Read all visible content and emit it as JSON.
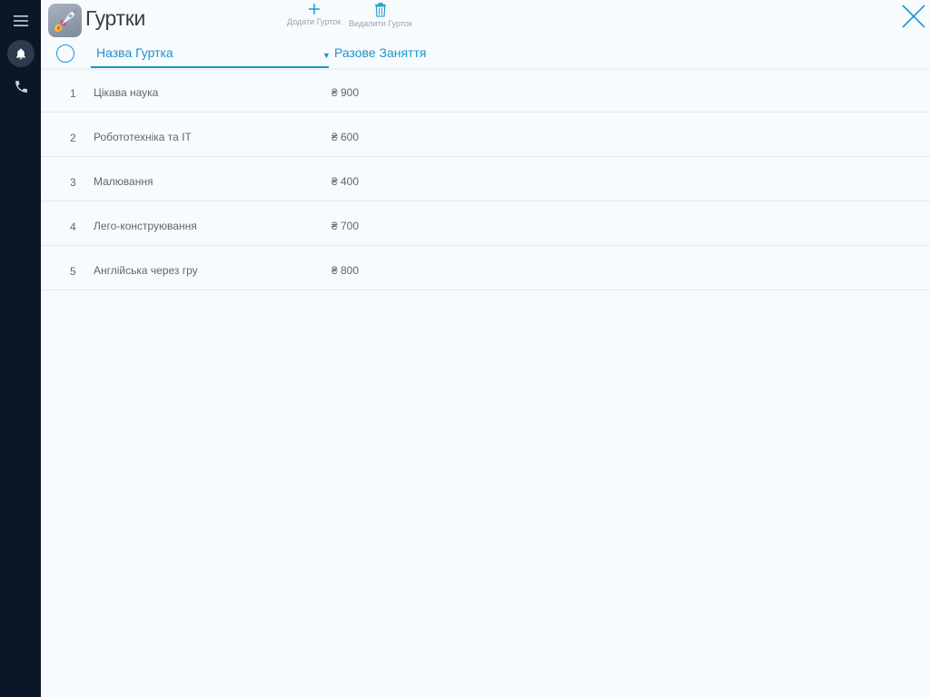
{
  "sidebar": {
    "items": [
      {
        "icon": "menu-icon"
      },
      {
        "icon": "bell-icon"
      },
      {
        "icon": "phone-icon"
      }
    ]
  },
  "header": {
    "title": "Гуртки",
    "add_label": "Додати Гурток",
    "delete_label": "Видалити Гурток"
  },
  "columns": {
    "name": "Назва Гуртка",
    "price": "Разове Заняття"
  },
  "rows": [
    {
      "num": "1",
      "name": "Цікава наука",
      "price": "₴ 900"
    },
    {
      "num": "2",
      "name": "Робототехніка та IT",
      "price": "₴ 600"
    },
    {
      "num": "3",
      "name": "Малювання",
      "price": "₴ 400"
    },
    {
      "num": "4",
      "name": "Лего-конструювання",
      "price": "₴ 700"
    },
    {
      "num": "5",
      "name": "Англійська через гру",
      "price": "₴ 800"
    }
  ],
  "colors": {
    "accent": "#1a94d1",
    "sidebar": "#0b1626",
    "background": "#f7fbfd"
  }
}
